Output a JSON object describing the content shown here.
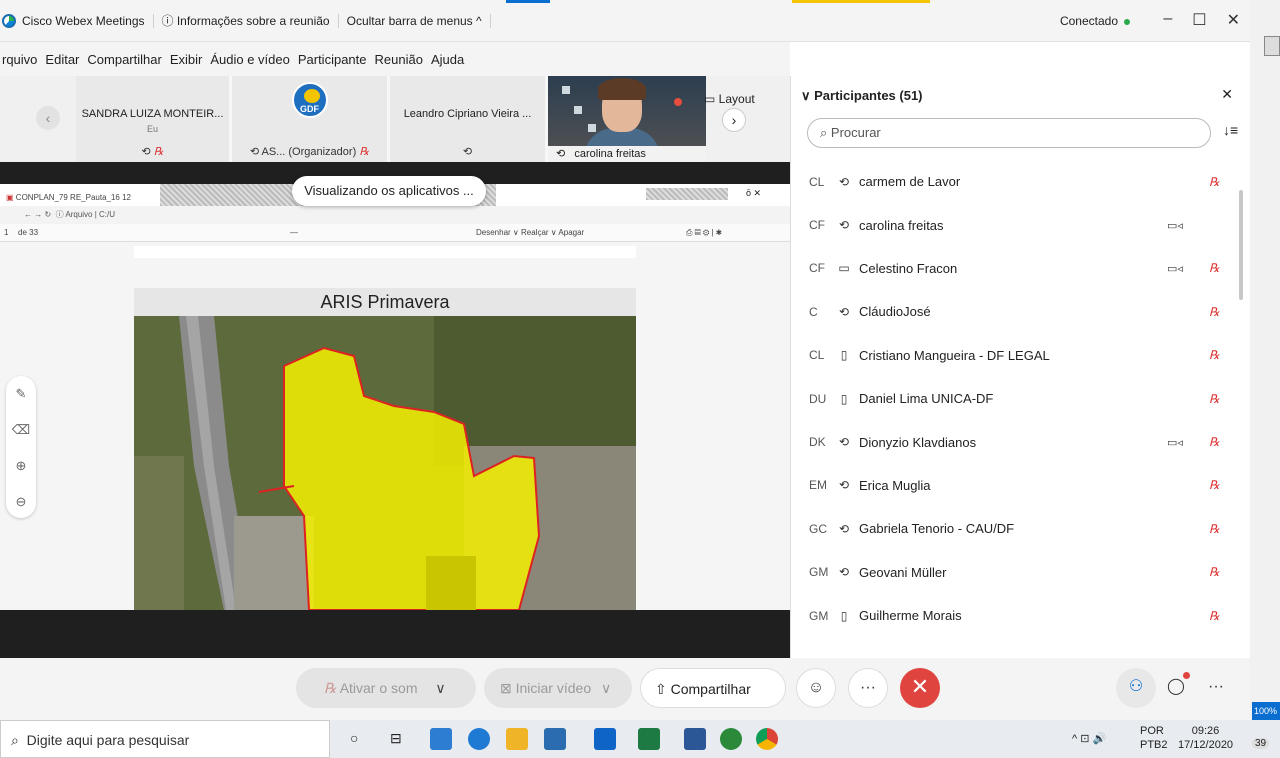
{
  "titlebar": {
    "app_name": "Cisco Webex Meetings",
    "meeting_info": "Informações sobre a reunião",
    "hide_menu": "Ocultar barra de menus ^",
    "status": "Conectado",
    "min": "–",
    "max": "☐",
    "close": "✕"
  },
  "menu": [
    "rquivo",
    "Editar",
    "Compartilhar",
    "Exibir",
    "Áudio e vídeo",
    "Participante",
    "Reunião",
    "Ajuda"
  ],
  "strip": {
    "tiles": [
      {
        "name": "SANDRA LUIZA MONTEIR...",
        "sub": "Eu",
        "foot": "♪ ℞"
      },
      {
        "name": "",
        "sub": "",
        "foot": "AS... (Organizador)",
        "logo": "GDF"
      },
      {
        "name": "Leandro Cipriano Vieira ...",
        "sub": "",
        "foot": "♪"
      },
      {
        "name": "carolina freitas"
      }
    ],
    "layout_label": "Layout"
  },
  "share": {
    "viewing_pill": "Visualizando os aplicativos ...",
    "browser_tab": "CONPLAN_79 RE_Pauta_16 12 2...",
    "address": "Arquivo | C:/U",
    "page_indicator": "de 33",
    "pdf_tools": "Desenhar ∨  Realçar ∨  Apagar",
    "slide_title": "ARIS Primavera"
  },
  "controls": {
    "mute_label": "Ativar o som",
    "video_label": "Iniciar vídeo",
    "share_label": "Compartilhar",
    "emoji": "☺",
    "more": "···",
    "end": "✕"
  },
  "panel": {
    "title": "Participantes (51)",
    "search_placeholder": "Procurar",
    "participants": [
      {
        "ini": "CL",
        "device": "audio",
        "name": "carmem de Lavor",
        "cam": false,
        "mute": true
      },
      {
        "ini": "CF",
        "device": "audio",
        "name": "carolina freitas",
        "cam": true,
        "mute": false
      },
      {
        "ini": "CF",
        "device": "computer",
        "name": "Celestino Fracon",
        "cam": true,
        "mute": true
      },
      {
        "ini": "C",
        "device": "audio",
        "name": "CláudioJosé",
        "cam": false,
        "mute": true
      },
      {
        "ini": "CL",
        "device": "phone",
        "name": "Cristiano Mangueira - DF LEGAL",
        "cam": false,
        "mute": true
      },
      {
        "ini": "DU",
        "device": "phone",
        "name": "Daniel Lima UNICA-DF",
        "cam": false,
        "mute": true
      },
      {
        "ini": "DK",
        "device": "audio",
        "name": "Dionyzio Klavdianos",
        "cam": true,
        "mute": true
      },
      {
        "ini": "EM",
        "device": "audio",
        "name": "Erica Muglia",
        "cam": false,
        "mute": true
      },
      {
        "ini": "GC",
        "device": "audio",
        "name": "Gabriela Tenorio - CAU/DF",
        "cam": false,
        "mute": true
      },
      {
        "ini": "GM",
        "device": "audio",
        "name": "Geovani Müller",
        "cam": false,
        "mute": true
      },
      {
        "ini": "GM",
        "device": "phone",
        "name": "Guilherme Morais",
        "cam": false,
        "mute": true
      }
    ]
  },
  "taskbar": {
    "search": "Digite aqui para pesquisar",
    "lang_top": "POR",
    "lang_bottom": "PTB2",
    "time": "09:26",
    "date": "17/12/2020",
    "badge": "39",
    "zoom": "100%"
  },
  "colors": {
    "accent_blue": "#0a6ed1",
    "end_red": "#e0443e",
    "status_green": "#2aa84a",
    "highlight_yellow": "#f4f000"
  }
}
